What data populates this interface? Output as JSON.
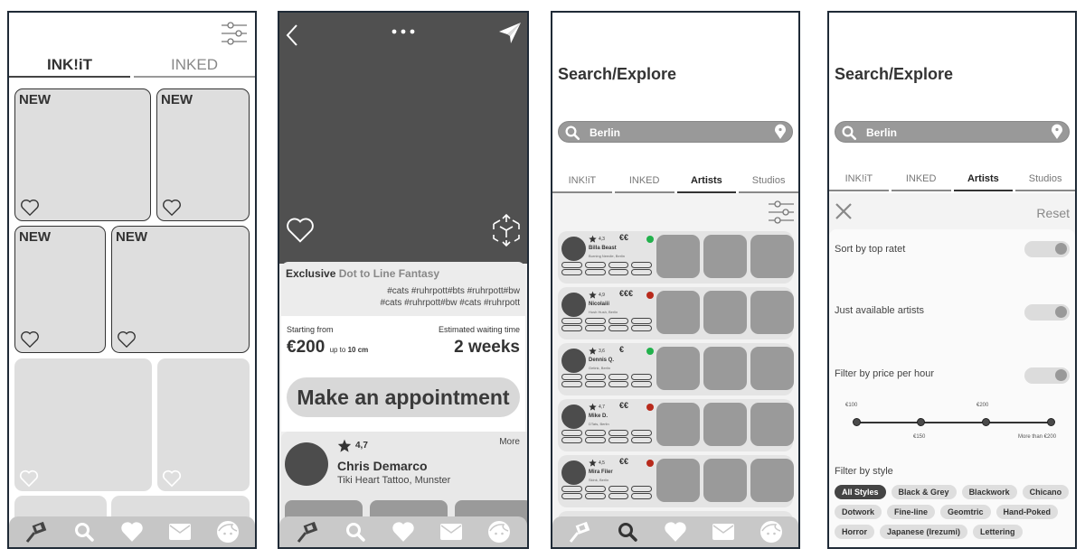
{
  "screen1": {
    "tabs": [
      {
        "label": "INK!iT",
        "active": true
      },
      {
        "label": "INKED",
        "active": false
      }
    ],
    "new_badge": "NEW",
    "cards_with_badge": 4
  },
  "screen2": {
    "info": {
      "title_bold": "Exclusive",
      "title_rest": "Dot to Line Fantasy",
      "tags_line1": "#cats #ruhrpott#bts #ruhrpott#bw",
      "tags_line2": "#cats #ruhrpott#bw #cats #ruhrpott"
    },
    "pricing": {
      "starting_label": "Starting from",
      "price": "€200",
      "size_prefix": "up to",
      "size": "10 cm",
      "waiting_label": "Estimated waiting time",
      "waiting_value": "2 weeks"
    },
    "appointment_button": "Make an appointment",
    "artist": {
      "rating": "4,7",
      "name": "Chris Demarco",
      "studio": "Tiki Heart Tattoo, Munster",
      "more": "More"
    }
  },
  "screen3": {
    "title": "Search/Explore",
    "search_value": "Berlin",
    "tabs": [
      {
        "label": "INK!iT"
      },
      {
        "label": "INKED"
      },
      {
        "label": "Artists",
        "active": true
      },
      {
        "label": "Studios"
      }
    ],
    "artists": [
      {
        "rating": "4,3",
        "price": "€€",
        "available": true,
        "name": "Billa Beast",
        "location": "Burning Needle, Berlin"
      },
      {
        "rating": "4,9",
        "price": "€€€",
        "available": false,
        "name": "Nicolaiii",
        "location": "Hush Hush, Berlin"
      },
      {
        "rating": "3,6",
        "price": "€",
        "available": true,
        "name": "Dennis Q.",
        "location": "Getink, Berlin"
      },
      {
        "rating": "4,7",
        "price": "€€",
        "available": false,
        "name": "Mike D.",
        "location": "DTats, Berlin"
      },
      {
        "rating": "4,5",
        "price": "€€",
        "available": false,
        "name": "Mira Filer",
        "location": "Skink, Berlin"
      }
    ],
    "status_colors": {
      "available": "#22b14c",
      "unavailable": "#b82a1c"
    }
  },
  "screen4": {
    "title": "Search/Explore",
    "search_value": "Berlin",
    "tabs": [
      {
        "label": "INK!iT"
      },
      {
        "label": "INKED"
      },
      {
        "label": "Artists",
        "active": true
      },
      {
        "label": "Studios"
      }
    ],
    "reset": "Reset",
    "options": [
      {
        "label": "Sort by top ratet",
        "on": true
      },
      {
        "label": "Just available artists",
        "on": true
      },
      {
        "label": "Filter by price per hour",
        "on": true
      }
    ],
    "price_stops": [
      "€100",
      "€150",
      "€200",
      "More than €200"
    ],
    "style_heading": "Filter by style",
    "styles": [
      "All Styles",
      "Black & Grey",
      "Blackwork",
      "Chicano",
      "Dotwork",
      "Fine-line",
      "Geomtric",
      "Hand-Poked",
      "Horror",
      "Japanese (Irezumi)",
      "Lettering"
    ],
    "selected_style": "All Styles"
  }
}
